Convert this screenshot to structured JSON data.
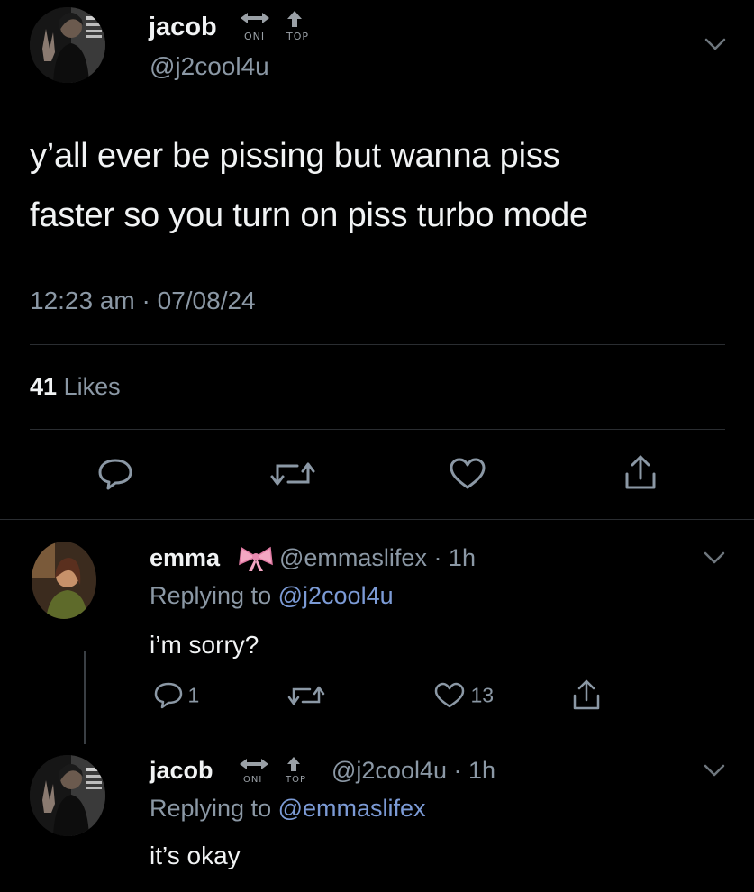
{
  "main_tweet": {
    "display_name": "jacob",
    "handle": "@j2cool4u",
    "flair_left": "ONI",
    "flair_right": "TOP",
    "text_line1": "y’all ever be pissing but wanna piss",
    "text_line2": "faster so you turn on piss turbo mode",
    "timestamp": "12:23 am · 07/08/24",
    "likes_count": "41",
    "likes_label": "Likes"
  },
  "reply1": {
    "display_name": "emma",
    "handle_time": "@emmaslifex · 1h",
    "replying_prefix": "Replying to",
    "replying_handle": "@j2cool4u",
    "text": "i’m sorry?",
    "reply_count": "1",
    "like_count": "13"
  },
  "reply2": {
    "display_name": "jacob",
    "flair_left": "ONI",
    "flair_right": "TOP",
    "handle_time": "@j2cool4u · 1h",
    "replying_prefix": "Replying to",
    "replying_handle": "@emmaslifex",
    "text": "it’s okay"
  },
  "icons": {
    "reply": "speech-bubble-icon",
    "retweet": "retweet-arrows-icon",
    "like": "heart-icon",
    "share": "share-upload-icon",
    "more": "chevron-down-icon",
    "bow": "pink-bow-emoji-icon"
  },
  "colors": {
    "background": "#000000",
    "text": "#e7e9ea",
    "muted": "#8b98a5",
    "link": "#7c9bd6",
    "bow": "#f4a7c3"
  }
}
